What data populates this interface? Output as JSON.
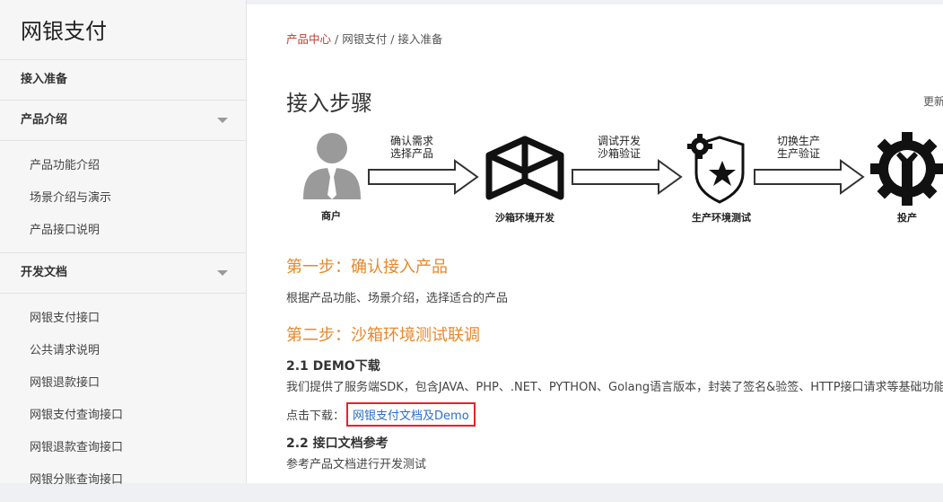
{
  "sidebar": {
    "title": "网银支付",
    "sections": [
      {
        "label": "接入准备"
      },
      {
        "label": "产品介绍",
        "items": [
          "产品功能介绍",
          "场景介绍与演示",
          "产品接口说明"
        ]
      },
      {
        "label": "开发文档",
        "items": [
          "网银支付接口",
          "公共请求说明",
          "网银退款接口",
          "网银支付查询接口",
          "网银退款查询接口",
          "网银分账查询接口"
        ]
      }
    ]
  },
  "breadcrumb": {
    "home": "产品中心",
    "sep": "/",
    "level2": "网银支付",
    "current": "接入准备"
  },
  "main": {
    "title": "接入步骤",
    "update_label": "更新",
    "flow": {
      "nodes": [
        {
          "label": "商户",
          "icon": "merchant-icon"
        },
        {
          "label": "沙箱环境开发",
          "icon": "box-icon"
        },
        {
          "label": "生产环境测试",
          "icon": "gear-shield-icon"
        },
        {
          "label": "投产",
          "icon": "gear-wrench-icon"
        }
      ],
      "arrows": [
        {
          "line1": "确认需求",
          "line2": "选择产品"
        },
        {
          "line1": "调试开发",
          "line2": "沙箱验证"
        },
        {
          "line1": "切换生产",
          "line2": "生产验证"
        }
      ]
    },
    "step1": {
      "title": "第一步：确认接入产品",
      "desc": "根据产品功能、场景介绍，选择适合的产品"
    },
    "step2": {
      "title": "第二步：沙箱环境测试联调",
      "demo_title": "2.1 DEMO下载",
      "demo_desc": "我们提供了服务端SDK，包含JAVA、PHP、.NET、PYTHON、Golang语言版本，封装了签名&验签、HTTP接口请求等基础功能",
      "download_label": "点击下载：",
      "download_link": "网银支付文档及Demo",
      "ref_title": "2.2 接口文档参考",
      "ref_desc": "参考产品文档进行开发测试"
    }
  },
  "colors": {
    "accent_orange": "#e8882a",
    "breadcrumb_red": "#c0392b",
    "link_blue": "#2a6fc9",
    "highlight_red": "#e0262a"
  }
}
